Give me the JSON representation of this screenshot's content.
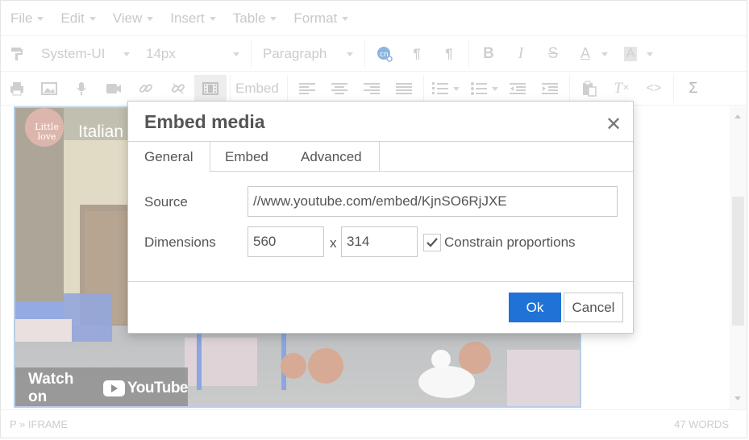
{
  "menubar": {
    "items": [
      {
        "label": "File"
      },
      {
        "label": "Edit"
      },
      {
        "label": "View"
      },
      {
        "label": "Insert"
      },
      {
        "label": "Table"
      },
      {
        "label": "Format"
      }
    ]
  },
  "toolbar": {
    "font_family": "System-UI",
    "font_size": "14px",
    "block_format": "Paragraph",
    "embed_label": "Embed"
  },
  "video": {
    "channel_title": "Italian",
    "logo_text": "Little love",
    "watch_on": "Watch on",
    "youtube_label": "YouTube"
  },
  "statusbar": {
    "path": "P » IFRAME",
    "word_count": "47 WORDS"
  },
  "dialog": {
    "title": "Embed media",
    "tabs": [
      {
        "label": "General"
      },
      {
        "label": "Embed"
      },
      {
        "label": "Advanced"
      }
    ],
    "source_label": "Source",
    "source_value": "//www.youtube.com/embed/KjnSO6RjJXE",
    "dimensions_label": "Dimensions",
    "width_value": "560",
    "by_label": "x",
    "height_value": "314",
    "constrain_label": "Constrain proportions",
    "constrain_checked": true,
    "ok_label": "Ok",
    "cancel_label": "Cancel"
  },
  "colors": {
    "accent": "#1f73d6"
  }
}
